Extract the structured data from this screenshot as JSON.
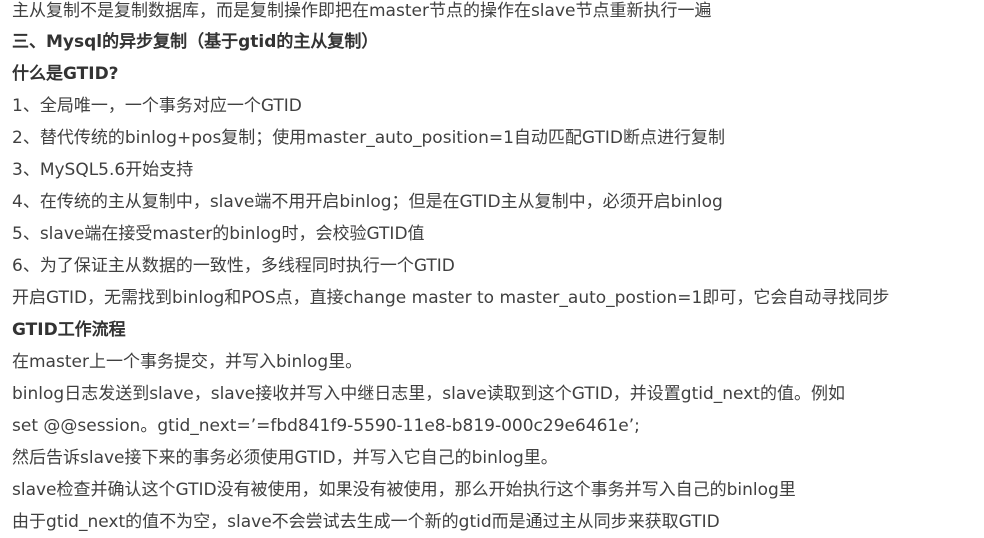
{
  "document": {
    "lines": [
      {
        "text": "主从复制不是复制数据库，而是复制操作即把在master节点的操作在slave节点重新执行一遍",
        "bold": false
      },
      {
        "text": "三、Mysql的异步复制（基于gtid的主从复制）",
        "bold": true
      },
      {
        "text": "什么是GTID?",
        "bold": true
      },
      {
        "text": "1、全局唯一，一个事务对应一个GTID",
        "bold": false
      },
      {
        "text": "2、替代传统的binlog+pos复制；使用master_auto_position=1自动匹配GTID断点进行复制",
        "bold": false
      },
      {
        "text": "3、MySQL5.6开始支持",
        "bold": false
      },
      {
        "text": "4、在传统的主从复制中，slave端不用开启binlog；但是在GTID主从复制中，必须开启binlog",
        "bold": false
      },
      {
        "text": "5、slave端在接受master的binlog时，会校验GTID值",
        "bold": false
      },
      {
        "text": "6、为了保证主从数据的一致性，多线程同时执行一个GTID",
        "bold": false
      },
      {
        "text": "开启GTID，无需找到binlog和POS点，直接change master to master_auto_postion=1即可，它会自动寻找同步",
        "bold": false
      },
      {
        "text": "GTID工作流程",
        "bold": true
      },
      {
        "text": "在master上一个事务提交，并写入binlog里。",
        "bold": false
      },
      {
        "text": "binlog日志发送到slave，slave接收并写入中继日志里，slave读取到这个GTID，并设置gtid_next的值。例如",
        "bold": false
      },
      {
        "text": "set @@session。gtid_next=’=fbd841f9-5590-11e8-b819-000c29e6461e’;",
        "bold": false
      },
      {
        "text": "然后告诉slave接下来的事务必须使用GTID，并写入它自己的binlog里。",
        "bold": false
      },
      {
        "text": "slave检查并确认这个GTID没有被使用，如果没有被使用，那么开始执行这个事务并写入自己的binlog里",
        "bold": false
      },
      {
        "text": "由于gtid_next的值不为空，slave不会尝试去生成一个新的gtid而是通过主从同步来获取GTID",
        "bold": false
      }
    ]
  }
}
